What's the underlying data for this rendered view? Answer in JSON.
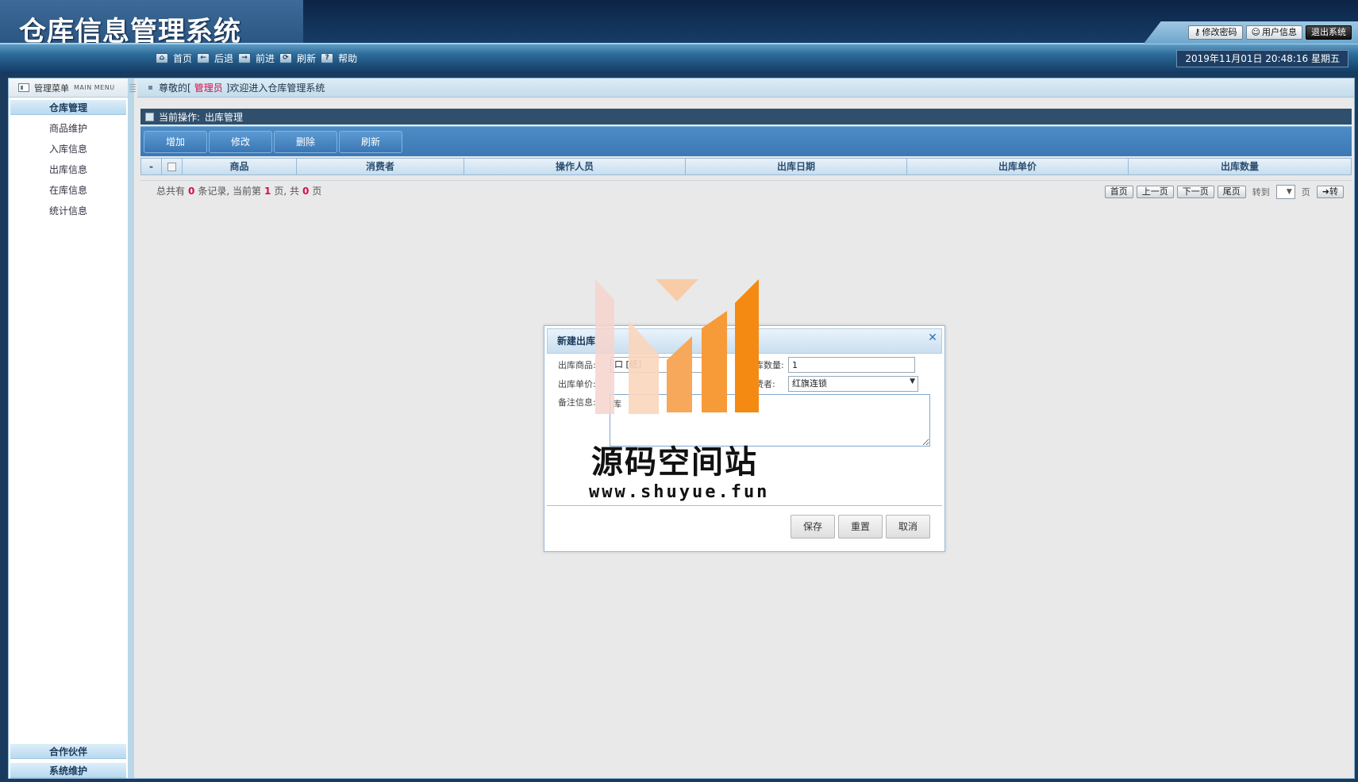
{
  "app": {
    "title": "仓库信息管理系统"
  },
  "header": {
    "buttons": [
      {
        "label": "修改密码",
        "icon": "key-icon"
      },
      {
        "label": "用户信息",
        "icon": "user-icon"
      },
      {
        "label": "退出系统",
        "icon": ""
      }
    ],
    "nav": [
      {
        "label": "首页",
        "icon": "home-icon"
      },
      {
        "label": "后退",
        "icon": "back-arrow-icon"
      },
      {
        "label": "前进",
        "icon": "forward-arrow-icon"
      },
      {
        "label": "刷新",
        "icon": "refresh-icon"
      },
      {
        "label": "帮助",
        "icon": "help-icon"
      }
    ],
    "datetime": "2019年11月01日 20:48:16 星期五"
  },
  "sidebar": {
    "title": "管理菜单",
    "title_en": "MAIN MENU",
    "groups": [
      {
        "label": "仓库管理",
        "items": [
          "商品维护",
          "入库信息",
          "出库信息",
          "在库信息",
          "统计信息"
        ]
      },
      {
        "label": "合作伙伴"
      },
      {
        "label": "系统维护"
      }
    ]
  },
  "welcome": {
    "prefix": "尊敬的[",
    "role": "管理员",
    "suffix": "]欢迎进入仓库管理系统"
  },
  "breadcrumb": {
    "label": "当前操作:",
    "value": "出库管理"
  },
  "toolbar": {
    "add": "增加",
    "edit": "修改",
    "delete": "删除",
    "refresh": "刷新"
  },
  "grid": {
    "columns": [
      "-",
      "",
      "商品",
      "消费者",
      "操作人员",
      "出库日期",
      "出库单价",
      "出库数量"
    ],
    "rows": []
  },
  "pager": {
    "t1": "总共有",
    "total": "0",
    "t2": "条记录, 当前第",
    "current": "1",
    "t3": "页, 共",
    "pages": "0",
    "t4": "页",
    "first": "首页",
    "prev": "上一页",
    "next": "下一页",
    "last": "尾页",
    "goto": "转到",
    "page_unit": "页",
    "go": "➜转"
  },
  "modal": {
    "title": "新建出库",
    "fields": {
      "product_label": "出库商品:",
      "product_value": "口 [纸]",
      "qty_label": "库数量:",
      "qty_value": "1",
      "price_label": "出库单价:",
      "price_value": "",
      "consumer_label": "费者:",
      "consumer_value": "红旗连锁",
      "remark_label": "备注信息:",
      "remark_value": "库"
    },
    "buttons": {
      "save": "保存",
      "reset": "重置",
      "cancel": "取消"
    }
  },
  "watermark": {
    "name": "源码空间站",
    "url": "www.shuyue.fun"
  },
  "colors": {
    "accent": "#3c78b4",
    "header_dark": "#0c2446",
    "highlight": "#d0104c"
  }
}
